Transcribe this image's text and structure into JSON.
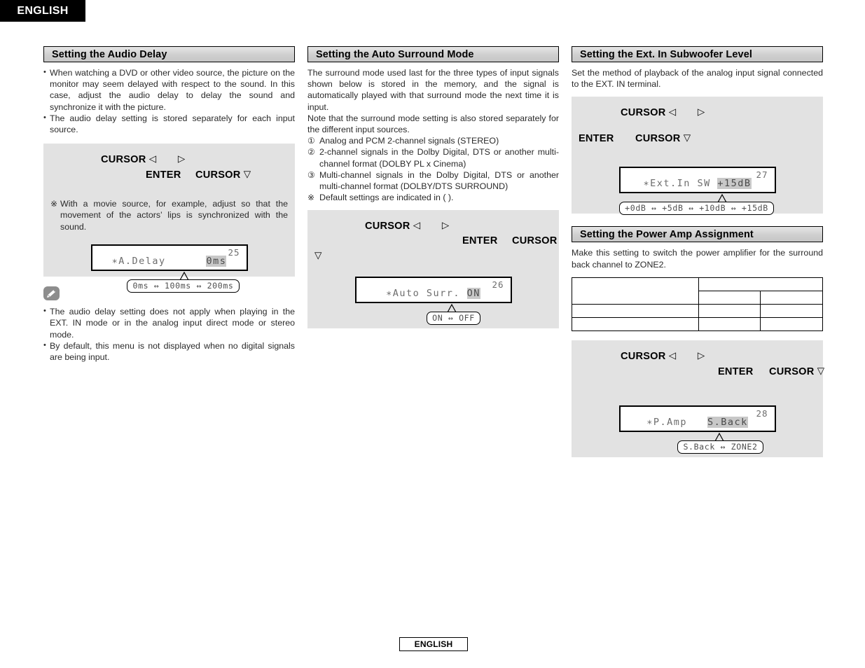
{
  "page": {
    "language_banner": "ENGLISH",
    "footer_language": "ENGLISH"
  },
  "columns": {
    "left": {
      "section": {
        "title": "Setting the Audio Delay",
        "bullets": [
          "When watching a DVD or other video source, the picture on the monitor may seem delayed with respect to the sound. In this case, adjust the audio delay to delay the sound and synchronize it with the picture.",
          "The audio delay setting is stored separately for each input source."
        ],
        "panel": {
          "key_row_1": "CURSOR",
          "key_row_1_left_tri": "◁",
          "key_row_1_right_tri": "▷",
          "key_row_2_enter": "ENTER",
          "key_row_2_cursor": "CURSOR",
          "key_row_2_down_tri": "▽",
          "note_mark": "※",
          "note_text": "With a movie source, for example, adjust so that the movement of the actors’ lips is synchronized with the sound.",
          "display": {
            "number": "25",
            "label": "∗A.Delay",
            "value": "0ms",
            "callout": "0ms ↔ 100ms ↔ 200ms",
            "callout_options": [
              "0ms",
              "100ms",
              "200ms"
            ]
          }
        },
        "memo": {
          "icon": "pencil-icon",
          "bullets": [
            "The audio delay setting does not apply when playing in the EXT. IN mode or in the analog input direct mode or stereo mode.",
            "By default, this menu is not displayed when no digital signals are being input."
          ]
        }
      }
    },
    "middle": {
      "section": {
        "title": "Setting the Auto Surround Mode",
        "paragraphs": [
          "The surround mode used last for the three types of input signals shown below is stored in the memory, and the signal is automatically played with that surround mode the next time it is input.",
          "Note that the surround mode setting is also stored separately for the different input sources."
        ],
        "list": [
          {
            "mark": "①",
            "text": "Analog and PCM 2-channel signals (STEREO)"
          },
          {
            "mark": "②",
            "text": "2-channel signals in the Dolby Digital, DTS or another multi-channel format (DOLBY PL  x Cinema)"
          },
          {
            "mark": "③",
            "text": "Multi-channel signals in the Dolby Digital, DTS or another multi-channel format (DOLBY/DTS SURROUND)"
          },
          {
            "mark": "※",
            "text": "Default settings are indicated in (  )."
          }
        ],
        "panel": {
          "key_row_1": "CURSOR",
          "key_row_1_left_tri": "◁",
          "key_row_1_right_tri": "▷",
          "key_row_2_enter": "ENTER",
          "key_row_2_cursor": "CURSOR",
          "key_row_3_down_tri": "▽",
          "display": {
            "number": "26",
            "label": "∗Auto Surr.",
            "value": "ON",
            "callout": "ON ↔ OFF",
            "callout_options": [
              "ON",
              "OFF"
            ]
          }
        }
      }
    },
    "right": {
      "section_subwoofer": {
        "title": "Setting the Ext. In Subwoofer Level",
        "paragraph": "Set the method of playback of the analog input signal connected to the EXT. IN terminal.",
        "panel": {
          "key_row_1": "CURSOR",
          "key_row_1_left_tri": "◁",
          "key_row_1_right_tri": "▷",
          "key_row_2_enter": "ENTER",
          "key_row_2_cursor": "CURSOR",
          "key_row_2_down_tri": "▽",
          "display": {
            "number": "27",
            "label": "∗Ext.In SW",
            "value": "+15dB",
            "callout": "+0dB ↔ +5dB ↔ +10dB ↔ +15dB",
            "callout_options": [
              "+0dB",
              "+5dB",
              "+10dB",
              "+15dB"
            ]
          }
        }
      },
      "section_poweramp": {
        "title": "Setting the Power Amp Assignment",
        "paragraph": "Make this setting to switch the power amplifier for the surround back channel to ZONE2.",
        "table": {
          "rows": [
            [
              "",
              "",
              ""
            ],
            [
              "",
              "",
              ""
            ],
            [
              "",
              "",
              ""
            ],
            [
              "",
              "",
              ""
            ]
          ]
        },
        "panel": {
          "key_row_1": "CURSOR",
          "key_row_1_left_tri": "◁",
          "key_row_1_right_tri": "▷",
          "key_row_2_enter": "ENTER",
          "key_row_2_cursor": "CURSOR",
          "key_row_2_down_tri": "▽",
          "display": {
            "number": "28",
            "label": "∗P.Amp",
            "value": "S.Back",
            "callout": "S.Back ↔ ZONE2",
            "callout_options": [
              "S.Back",
              "ZONE2"
            ]
          }
        }
      }
    }
  }
}
